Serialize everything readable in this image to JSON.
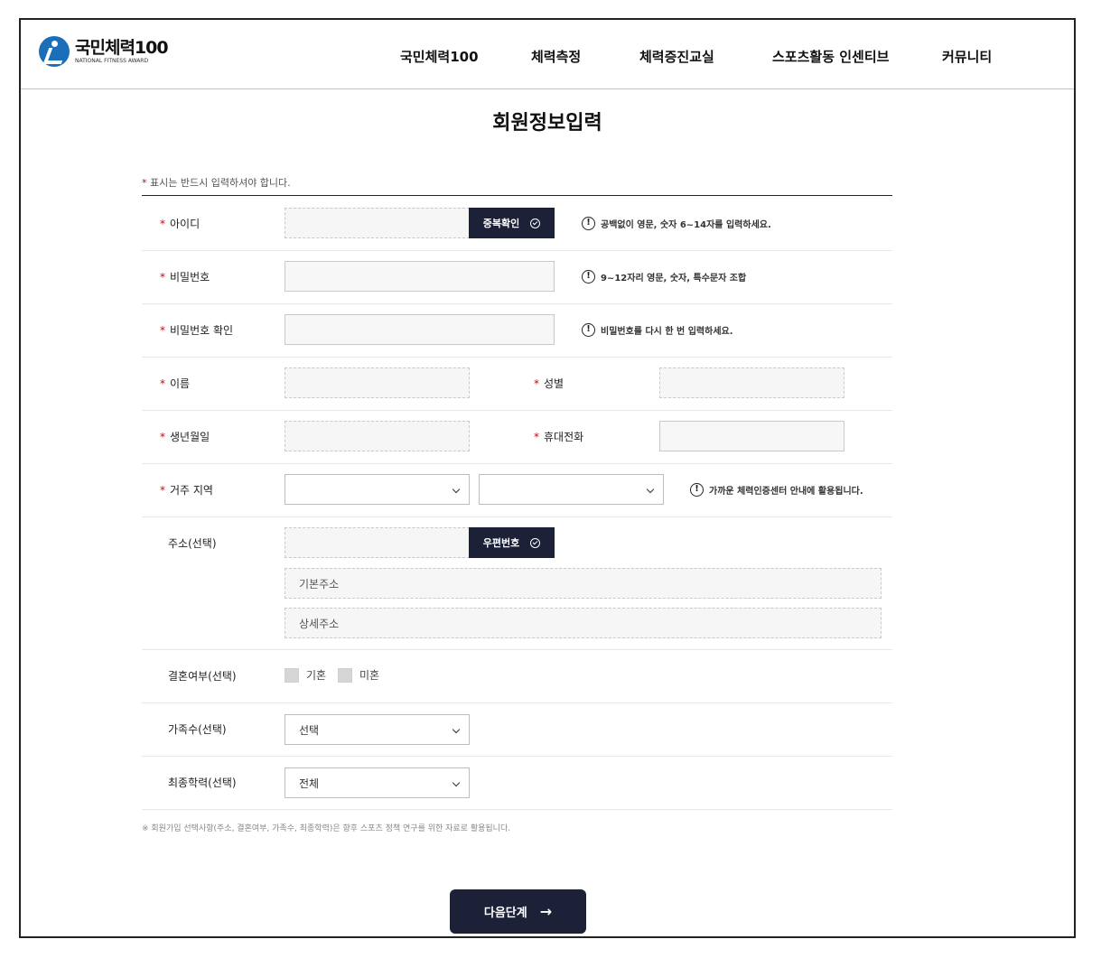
{
  "header": {
    "logo_text": "국민체력100",
    "logo_sub": "NATIONAL FITNESS AWARD",
    "nav": [
      "국민체력100",
      "체력측정",
      "체력증진교실",
      "스포츠활동 인센티브",
      "커뮤니티"
    ]
  },
  "page_title": "회원정보입력",
  "required_note": "표시는 반드시 입력하셔야 합니다.",
  "required_star": "*",
  "fields": {
    "id": {
      "label": "아이디",
      "button": "중복확인",
      "hint": "공백없이 영문, 숫자 6~14자를 입력하세요."
    },
    "password": {
      "label": "비밀번호",
      "hint": "9~12자리 영문, 숫자, 특수문자 조합"
    },
    "password_confirm": {
      "label": "비밀번호 확인",
      "hint": "비밀번호를 다시 한 번 입력하세요."
    },
    "name": {
      "label": "이름"
    },
    "gender": {
      "label": "성별"
    },
    "birth": {
      "label": "생년월일"
    },
    "phone": {
      "label": "휴대전화"
    },
    "region": {
      "label": "거주 지역",
      "hint": "가까운 체력인증센터 안내에 활용됩니다."
    },
    "address": {
      "label": "주소(선택)",
      "button": "우편번호",
      "base_placeholder": "기본주소",
      "detail_placeholder": "상세주소"
    },
    "marriage": {
      "label": "결혼여부(선택)",
      "options": [
        "기혼",
        "미혼"
      ]
    },
    "family": {
      "label": "가족수(선택)",
      "value": "선택"
    },
    "education": {
      "label": "최종학력(선택)",
      "value": "전체"
    }
  },
  "footnote": "※ 회원가입 선택사항(주소, 결혼여부, 가족수, 최종학력)은 향후 스포츠 정책 연구를 위한 자료로 활용됩니다.",
  "next_button": "다음단계",
  "alert_glyph": "!",
  "colors": {
    "primary": "#1c2138",
    "required": "#d0021b",
    "logo_blue": "#1a6fb8"
  }
}
